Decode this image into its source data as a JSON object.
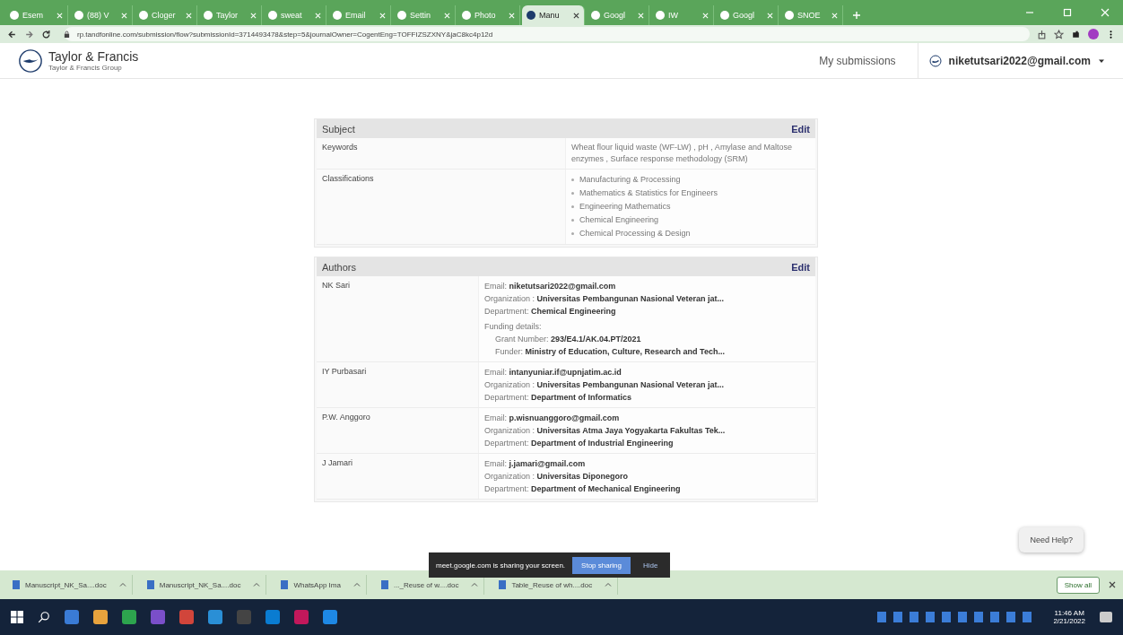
{
  "browser": {
    "tabs": [
      {
        "title": "Esem",
        "selected": false
      },
      {
        "title": "(88) V",
        "selected": false
      },
      {
        "title": "Cloger",
        "selected": false
      },
      {
        "title": "Taylor",
        "selected": false
      },
      {
        "title": "sweat",
        "selected": false
      },
      {
        "title": "Email",
        "selected": false
      },
      {
        "title": "Settin",
        "selected": false
      },
      {
        "title": "Photo",
        "selected": false
      },
      {
        "title": "Manu",
        "selected": true
      },
      {
        "title": "Googl",
        "selected": false
      },
      {
        "title": "IW",
        "selected": false
      },
      {
        "title": "Googl",
        "selected": false
      },
      {
        "title": "SNOE",
        "selected": false
      }
    ],
    "url": "rp.tandfonline.com/submission/flow?submissionId=3714493478&step=5&journalOwner=CogentEng=TOFFIZSZXNY&jaC8kc4p12d"
  },
  "header": {
    "brand": "Taylor & Francis",
    "brand_sub": "Taylor & Francis Group",
    "nav": "My submissions",
    "user": "niketutsari2022@gmail.com"
  },
  "subject": {
    "title": "Subject",
    "edit": "Edit",
    "rows": [
      {
        "label": "Keywords",
        "kind": "text",
        "value": "Wheat flour liquid waste (WF-LW) , pH , Amylase and Maltose enzymes , Surface response methodology (SRM)"
      },
      {
        "label": "Classifications",
        "kind": "list",
        "items": [
          "Manufacturing & Processing",
          "Mathematics & Statistics for Engineers",
          "Engineering Mathematics",
          "Chemical Engineering",
          "Chemical Processing & Design"
        ]
      }
    ]
  },
  "authors": {
    "title": "Authors",
    "edit": "Edit",
    "rows": [
      {
        "name": "NK Sari",
        "fields": [
          {
            "label": "Email:",
            "value": "niketutsari2022@gmail.com"
          },
          {
            "label": "Organization :",
            "value": "Universitas Pembangunan Nasional Veteran jat..."
          },
          {
            "label": "Department:",
            "value": "Chemical Engineering"
          }
        ],
        "funding": {
          "label": "Funding details:",
          "fields": [
            {
              "label": "Grant Number:",
              "value": "293/E4.1/AK.04.PT/2021"
            },
            {
              "label": "Funder:",
              "value": "Ministry of Education, Culture, Research and Tech..."
            }
          ]
        }
      },
      {
        "name": "IY Purbasari",
        "fields": [
          {
            "label": "Email:",
            "value": "intanyuniar.if@upnjatim.ac.id"
          },
          {
            "label": "Organization :",
            "value": "Universitas Pembangunan Nasional Veteran jat..."
          },
          {
            "label": "Department:",
            "value": "Department of Informatics"
          }
        ]
      },
      {
        "name": "P.W. Anggoro",
        "fields": [
          {
            "label": "Email:",
            "value": "p.wisnuanggoro@gmail.com"
          },
          {
            "label": "Organization :",
            "value": "Universitas Atma Jaya Yogyakarta Fakultas Tek..."
          },
          {
            "label": "Department:",
            "value": "Department of Industrial Engineering"
          }
        ]
      },
      {
        "name": "J Jamari",
        "fields": [
          {
            "label": "Email:",
            "value": "j.jamari@gmail.com"
          },
          {
            "label": "Organization :",
            "value": "Universitas Diponegoro"
          },
          {
            "label": "Department:",
            "value": "Department of Mechanical Engineering"
          }
        ]
      }
    ]
  },
  "need_help": "Need Help?",
  "downloads": [
    {
      "name": "Manuscript_NK_Sa....doc"
    },
    {
      "name": "Manuscript_NK_Sa....doc"
    },
    {
      "name": "WhatsApp Ima"
    },
    {
      "name": "..._Reuse of w....doc"
    },
    {
      "name": "Table_Reuse of wh....doc"
    }
  ],
  "show_all": "Show all",
  "sharing": {
    "message": "meet.google.com is sharing your screen.",
    "stop": "Stop sharing",
    "hide": "Hide"
  },
  "taskbar": {
    "time": "11:46 AM",
    "date": "2/21/2022"
  }
}
